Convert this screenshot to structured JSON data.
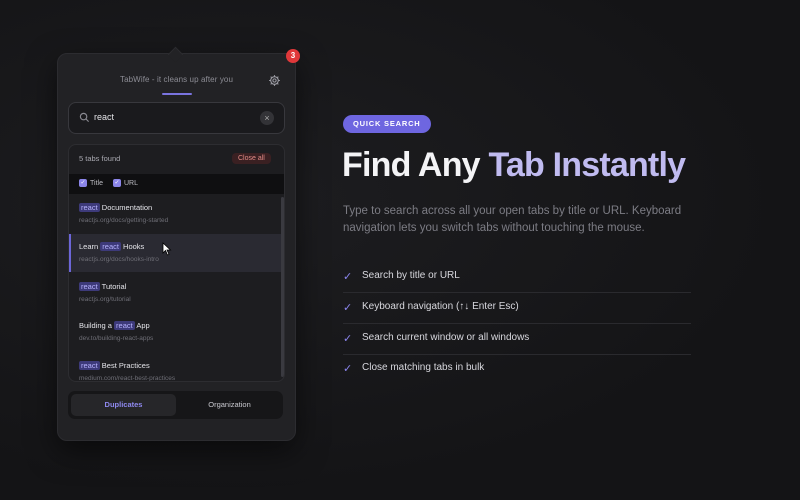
{
  "popup": {
    "header_title": "TabWife - it cleans up after you",
    "notification_count": "3",
    "search": {
      "value": "react",
      "clear_symbol": "×"
    },
    "results": {
      "count_label": "5 tabs found",
      "close_all_label": "Close all",
      "filters": [
        {
          "label": "Title",
          "checked": true
        },
        {
          "label": "URL",
          "checked": true
        }
      ],
      "items": [
        {
          "before": "",
          "highlight": "react",
          "after": " Documentation",
          "url": "reactjs.org/docs/getting-started"
        },
        {
          "before": "Learn ",
          "highlight": "react",
          "after": " Hooks",
          "url": "reactjs.org/docs/hooks-intro"
        },
        {
          "before": "",
          "highlight": "react",
          "after": " Tutorial",
          "url": "reactjs.org/tutorial"
        },
        {
          "before": "Building a ",
          "highlight": "react",
          "after": " App",
          "url": "dev.to/building-react-apps"
        },
        {
          "before": "",
          "highlight": "react",
          "after": " Best Practices",
          "url": "medium.com/react-best-practices"
        }
      ]
    },
    "bottom_tabs": {
      "duplicates": "Duplicates",
      "organization": "Organization"
    }
  },
  "hero": {
    "pill": "QUICK SEARCH",
    "title_part1": "Find Any",
    "title_part2": "Tab Instantly",
    "description": "Type to search across all your open tabs by title or URL. Keyboard navigation lets you switch tabs without touching the mouse.",
    "features": [
      "Search by title or URL",
      "Keyboard navigation (↑↓ Enter Esc)",
      "Search current window or all windows",
      "Close matching tabs in bulk"
    ],
    "check_symbol": "✓"
  },
  "colors": {
    "accent": "#6e66e0",
    "badge": "#e0383a",
    "background": "#161618"
  }
}
